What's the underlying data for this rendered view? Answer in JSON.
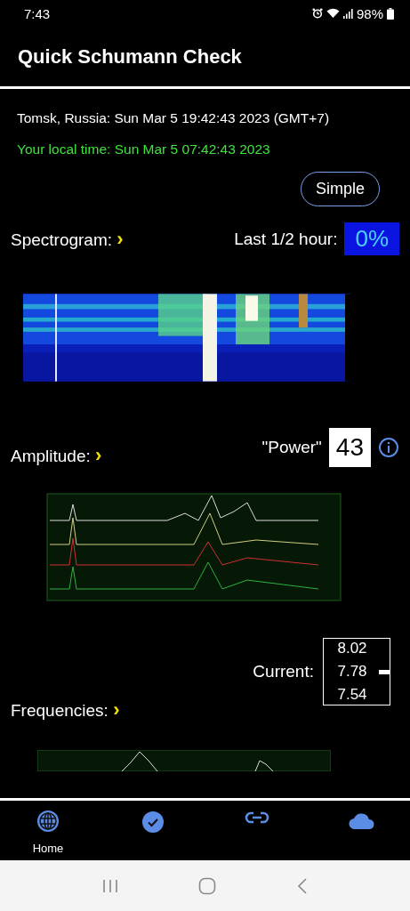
{
  "status_bar": {
    "time": "7:43",
    "battery": "98%"
  },
  "app_bar": {
    "title": "Quick Schumann Check"
  },
  "location_time": "Tomsk, Russia: Sun Mar  5 19:42:43 2023 (GMT+7)",
  "local_time": "Your local time: Sun Mar  5 07:42:43 2023",
  "mode_button": "Simple",
  "spectrogram": {
    "label": "Spectrogram:",
    "chevron": "›",
    "period_label": "Last 1/2 hour:",
    "period_value": "0%"
  },
  "amplitude": {
    "label": "Amplitude:",
    "chevron": "›",
    "power_label": "\"Power\"",
    "power_value": "43"
  },
  "frequencies": {
    "label": "Frequencies:",
    "chevron": "›",
    "current_label": "Current:",
    "scale": [
      "8.02",
      "7.78",
      "7.54"
    ]
  },
  "bottom_nav": {
    "home_label": "Home"
  }
}
